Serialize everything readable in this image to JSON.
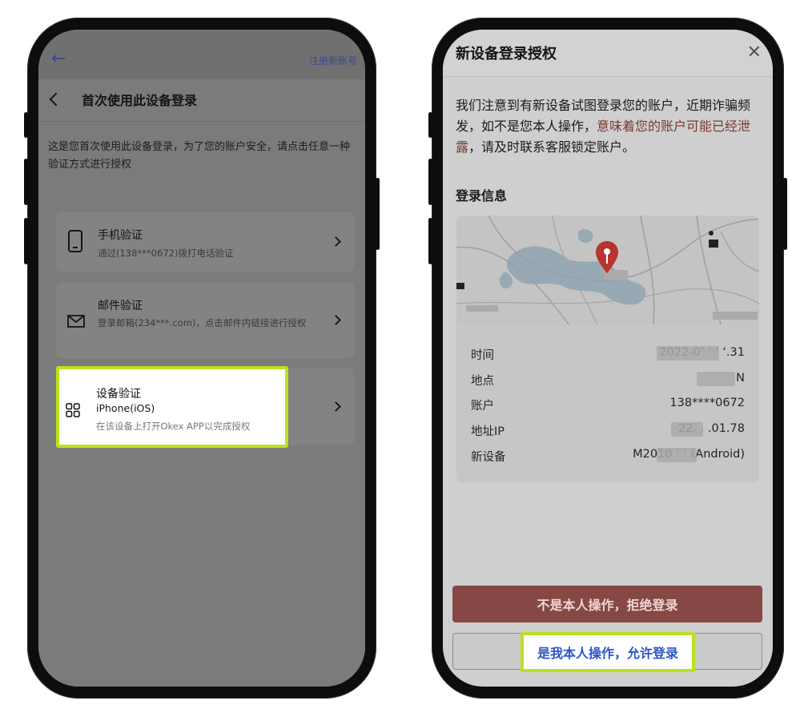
{
  "left_phone": {
    "topbar": {
      "back_icon": "arrow-left-icon",
      "register_link": "注册新账号"
    },
    "header": {
      "back_icon": "chevron-left-icon",
      "title": "首次使用此设备登录"
    },
    "description": "这是您首次使用此设备登录，为了您的账户安全，请点击任意一种验证方式进行授权",
    "methods": [
      {
        "icon": "phone-icon",
        "title": "手机验证",
        "subtitle": "通过(138***0672)拨打电话验证"
      },
      {
        "icon": "mail-icon",
        "title": "邮件验证",
        "subtitle": "登录邮箱(234***.com)，点击邮件内链接进行授权"
      },
      {
        "icon": "grid-icon",
        "title": "设备验证",
        "device": "iPhone(iOS)",
        "subtitle": "在该设备上打开Okex APP以完成授权",
        "highlighted": true
      }
    ]
  },
  "right_phone": {
    "header": {
      "title": "新设备登录授权",
      "close_icon": "close-icon"
    },
    "notice": {
      "text_before": "我们注意到有新设备试图登录您的账户，近期诈骗频发，如不是您本人操作，",
      "warning_text": "意味着您的账户可能已经泄露",
      "text_after": "，请及时联系客服锁定账户。",
      "warning_color": "#7a3a35"
    },
    "info_label": "登录信息",
    "map": {
      "pin_icon": "map-pin-icon",
      "pin_color": "#b8342c"
    },
    "info_rows": [
      {
        "key": "时间",
        "value": "2022-0‘ ‘ ‘  ‘.31"
      },
      {
        "key": "地点",
        "value": "N"
      },
      {
        "key": "账户",
        "value": "138****0672"
      },
      {
        "key": "地址IP",
        "value": "22.  .  .01.78"
      },
      {
        "key": "新设备",
        "value": "M2010   ‘ ‘ (Android)"
      }
    ],
    "buttons": {
      "deny": "不是本人操作，拒绝登录",
      "allow": "是我本人操作，允许登录"
    },
    "colors": {
      "deny_bg": "#864844",
      "allow_text": "#2c55c8",
      "highlight": "#b9e31f"
    }
  }
}
